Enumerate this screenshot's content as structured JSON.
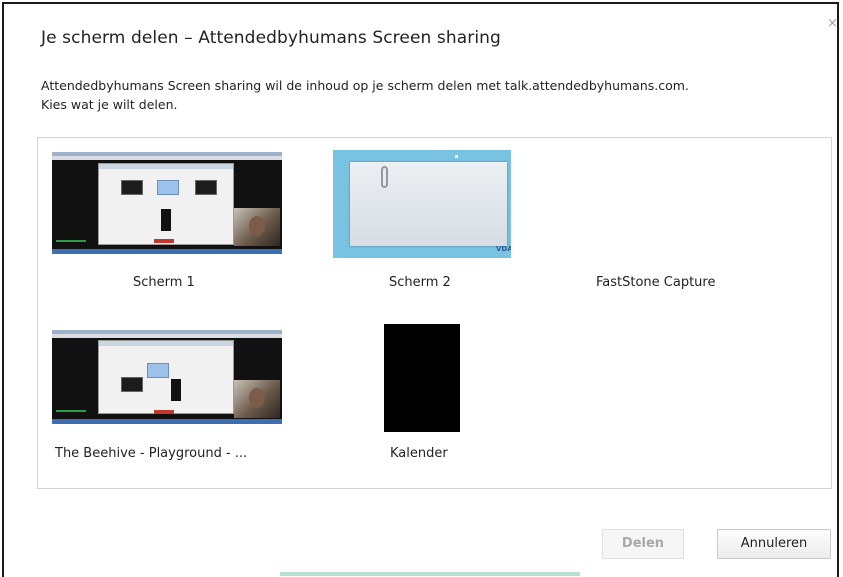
{
  "dialog": {
    "title": "Je scherm delen – Attendedbyhumans Screen sharing",
    "close_glyph": "×",
    "description_line1": "Attendedbyhumans Screen sharing wil de inhoud op je scherm delen met talk.attendedbyhumans.com.",
    "description_line2": "Kies wat je wilt delen."
  },
  "sources": [
    {
      "label": "Scherm 1",
      "thumb": "screen-capture"
    },
    {
      "label": "Scherm 2",
      "thumb": "blue-desktop"
    },
    {
      "label": "FastStone Capture",
      "thumb": "none"
    },
    {
      "label": "The Beehive - Playground - ...",
      "thumb": "screen-capture"
    },
    {
      "label": "Kalender",
      "thumb": "black-window"
    }
  ],
  "thumb2_logo": "VDAB",
  "buttons": {
    "share": "Delen",
    "cancel": "Annuleren"
  }
}
